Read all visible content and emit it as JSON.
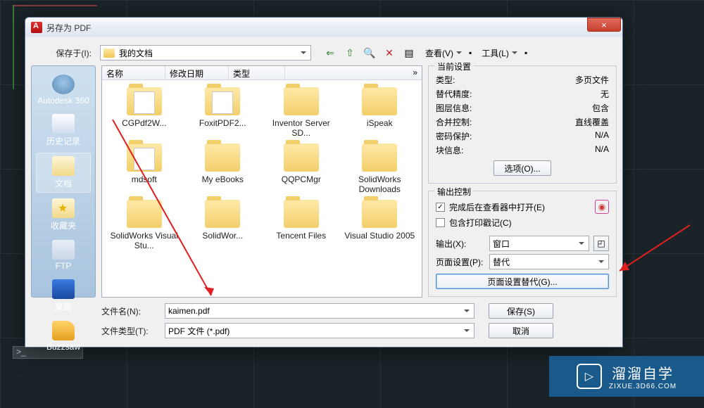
{
  "window": {
    "title": "另存为 PDF",
    "close": "×"
  },
  "saveIn": {
    "label": "保存于(I):",
    "value": "我的文档"
  },
  "toolbar": {
    "icons": {
      "back": "⇐",
      "up": "⇧",
      "search": "🔍",
      "delete": "✕",
      "new": "▤"
    },
    "view": "查看(V)",
    "tools": "工具(L)"
  },
  "sidebar": [
    {
      "key": "a360",
      "label": "Autodesk 360"
    },
    {
      "key": "hist",
      "label": "历史记录"
    },
    {
      "key": "doc",
      "label": "文档"
    },
    {
      "key": "fav",
      "label": "收藏夹"
    },
    {
      "key": "ftp",
      "label": "FTP"
    },
    {
      "key": "desk",
      "label": "桌面"
    },
    {
      "key": "buzz",
      "label": "Buzzsaw"
    }
  ],
  "fileHeader": {
    "name": "名称",
    "date": "修改日期",
    "type": "类型",
    "more": "»"
  },
  "folders": [
    "CGPdf2W...",
    "FoxitPDF2...",
    "Inventor Server SD...",
    "iSpeak",
    "mdsoft",
    "My eBooks",
    "QQPCMgr",
    "SolidWorks Downloads",
    "SolidWorks Visual Stu...",
    "SolidWor...",
    "Tencent Files",
    "Visual Studio 2005"
  ],
  "settings": {
    "title": "当前设置",
    "rows": {
      "type_k": "类型:",
      "type_v": "多页文件",
      "prec_k": "替代精度:",
      "prec_v": "无",
      "layer_k": "图层信息:",
      "layer_v": "包含",
      "merge_k": "合并控制:",
      "merge_v": "直线覆盖",
      "pwd_k": "密码保护:",
      "pwd_v": "N/A",
      "block_k": "块信息:",
      "block_v": "N/A"
    },
    "options_btn": "选项(O)..."
  },
  "output": {
    "title": "输出控制",
    "open_after": "完成后在查看器中打开(E)",
    "stamp": "包含打印戳记(C)",
    "export_label": "输出(X):",
    "export_value": "窗口",
    "pagesetup_label": "页面设置(P):",
    "pagesetup_value": "替代",
    "pagesetup_btn": "页面设置替代(G)..."
  },
  "bottom": {
    "filename_label": "文件名(N):",
    "filename_value": "kaimen.pdf",
    "filetype_label": "文件类型(T):",
    "filetype_value": "PDF 文件 (*.pdf)",
    "save": "保存(S)",
    "cancel": "取消"
  },
  "watermark": {
    "main": "溜溜自学",
    "sub": "ZIXUE.3D66.COM",
    "logo": "▷"
  }
}
